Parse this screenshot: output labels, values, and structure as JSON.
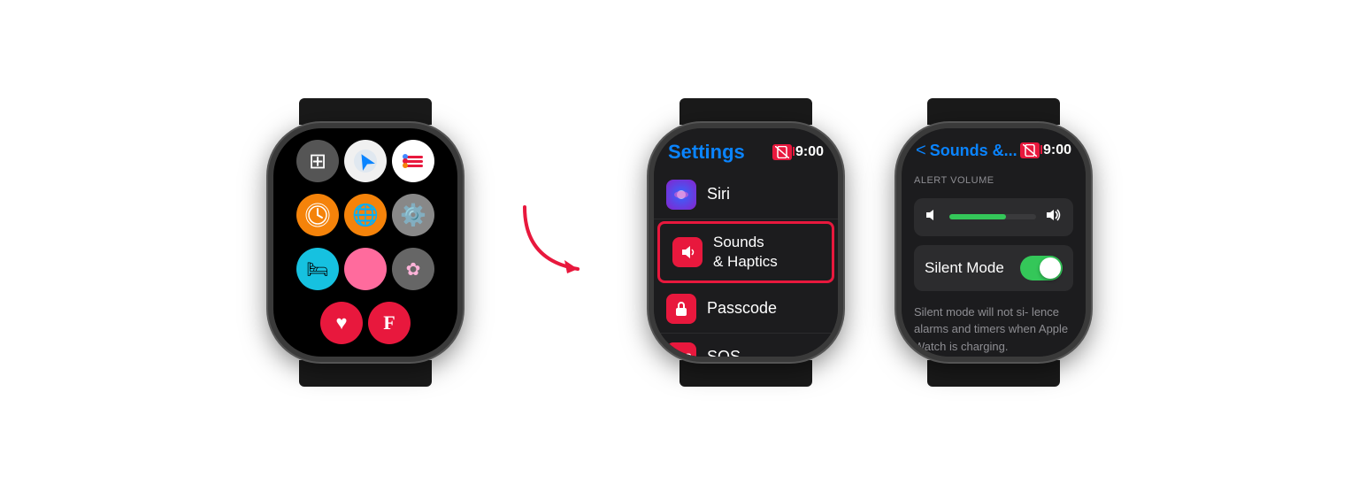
{
  "watch1": {
    "apps": [
      {
        "name": "calculator",
        "icon": "⊞",
        "bg": "#555"
      },
      {
        "name": "maps",
        "icon": "🗺",
        "bg": "#e8e8e8"
      },
      {
        "name": "reminders",
        "icon": "☰",
        "bg": "#fff"
      },
      {
        "name": "clock",
        "icon": "⏰",
        "bg": "#f5830a"
      },
      {
        "name": "globe",
        "icon": "🌐",
        "bg": "#f5830a"
      },
      {
        "name": "settings",
        "icon": "⚙",
        "bg": "#888"
      },
      {
        "name": "sleep",
        "icon": "🛏",
        "bg": "#16c1e0"
      },
      {
        "name": "pink",
        "icon": "",
        "bg": "#ff6b9d"
      },
      {
        "name": "breath",
        "icon": "❋",
        "bg": "#888"
      },
      {
        "name": "heart",
        "icon": "♥",
        "bg": "#e8183d"
      },
      {
        "name": "flipboard",
        "icon": "F",
        "bg": "#e8183d"
      }
    ]
  },
  "watch2": {
    "title": "Settings",
    "time": "9:00",
    "items": [
      {
        "label": "Siri",
        "icon_bg": "#888",
        "icon": "🔵"
      },
      {
        "label": "Sounds\n& Haptics",
        "icon_bg": "#e8183d",
        "icon": "🔊",
        "highlighted": true
      },
      {
        "label": "Passcode",
        "icon_bg": "#e8183d",
        "icon": "🔒"
      },
      {
        "label": "SOS",
        "icon_bg": "#e8183d",
        "icon": "SOS"
      }
    ]
  },
  "watch3": {
    "title": "Sounds &...",
    "time": "9:00",
    "section_label": "ALERT VOLUME",
    "volume_fill_percent": 65,
    "silent_mode_label": "Silent Mode",
    "silent_mode_enabled": true,
    "description": "Silent mode will not si-\nlence alarms and timers\nwhen Apple Watch is\ncharging."
  },
  "arrow": {
    "color": "#e8183d"
  }
}
